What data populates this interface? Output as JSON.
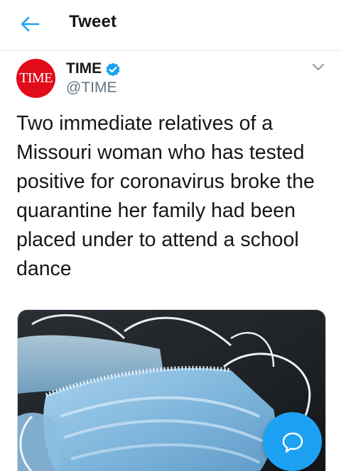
{
  "header": {
    "title": "Tweet",
    "back_icon": "arrow-left-icon"
  },
  "author": {
    "avatar_text": "TIME",
    "name": "TIME",
    "handle": "@TIME",
    "verified_icon": "verified-badge-icon",
    "menu_icon": "chevron-down-icon"
  },
  "tweet": {
    "text": "Two immediate relatives of a Missouri woman who has tested positive for coronavirus broke the quarantine her family had been placed under to attend a school dance"
  },
  "media": {
    "subject": "surgical-face-masks-photo"
  },
  "fab": {
    "icon": "reply-bubble-icon"
  },
  "colors": {
    "accent": "#1da1f2",
    "brand_red": "#e10b19",
    "secondary_text": "#657786",
    "divider": "#e1e8ed"
  }
}
